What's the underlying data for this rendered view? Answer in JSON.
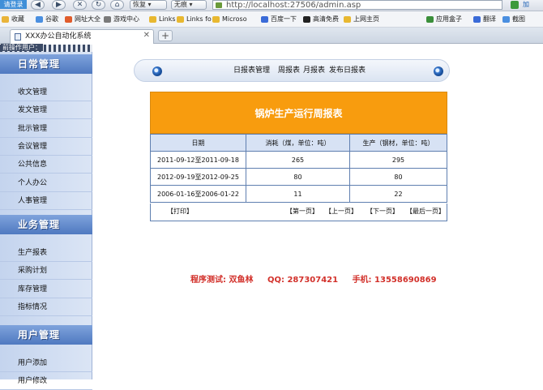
{
  "browser": {
    "login_label": "请登录",
    "restore_label": "恢复",
    "noimg_label": "无痕",
    "address": "http://localhost:27506/admin.asp",
    "addr_more": "加",
    "favorites": [
      {
        "label": "收藏",
        "color": "#e9b43a"
      },
      {
        "label": "谷歌",
        "color": "#4a8fe0"
      },
      {
        "label": "网址大全",
        "color": "#e05c2c"
      },
      {
        "label": "游戏中心",
        "color": "#7a7a7a"
      },
      {
        "label": "Links",
        "color": "#e8b830"
      },
      {
        "label": "Links fo",
        "color": "#e8b830"
      },
      {
        "label": "Microso",
        "color": "#e8b830"
      },
      {
        "label": "百度一下",
        "color": "#3a6bd8"
      },
      {
        "label": "高清免费",
        "color": "#222222"
      },
      {
        "label": "上网主页",
        "color": "#e8b830"
      },
      {
        "label": "应用盒子",
        "color": "#3a8f3a"
      },
      {
        "label": "翻译",
        "color": "#3a6bd8"
      },
      {
        "label": "截图",
        "color": "#4a8fe0"
      }
    ],
    "tab_title": "XXX办公自动化系统",
    "tab_close": "✕",
    "new_tab": "+"
  },
  "sidebar": {
    "login_strip": "前操作用户：",
    "sections": [
      {
        "title": "日常管理",
        "items": [
          "收文管理",
          "发文管理",
          "批示管理",
          "会议管理",
          "公共信息",
          "个人办公",
          "人事管理"
        ]
      },
      {
        "title": "业务管理",
        "items": [
          "生产报表",
          "采购计划",
          "库存管理",
          "指标情况"
        ]
      },
      {
        "title": "用户管理",
        "items": [
          "用户添加",
          "用户修改"
        ]
      }
    ]
  },
  "top_nav": {
    "links": [
      "日报表管理",
      "周报表",
      "月报表",
      "发布日报表"
    ]
  },
  "report": {
    "title": "锅炉生产运行周报表",
    "columns": [
      "日期",
      "消耗（煤，单位：吨）",
      "生产（钢材，单位：吨）"
    ],
    "rows": [
      [
        "2011-09-12至2011-09-18",
        "265",
        "295"
      ],
      [
        "2012-09-19至2012-09-25",
        "80",
        "80"
      ],
      [
        "2006-01-16至2006-01-22",
        "11",
        "22"
      ]
    ],
    "print": "【打印】",
    "first": "【第一页】",
    "prev": "【上一页】",
    "next": "【下一页】",
    "last": "【最后一页】"
  },
  "footer": {
    "tester": "程序测试: 双鱼林",
    "qq": "QQ: 287307421",
    "phone": "手机: 13558690869"
  },
  "colors": {
    "report_header": "#f89c0e",
    "footer_text": "#d2302a",
    "sidebar_head": "#4f79c0"
  }
}
